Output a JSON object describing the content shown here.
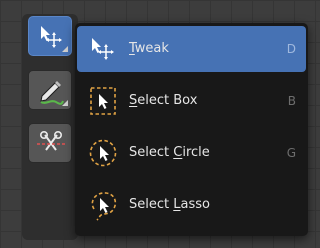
{
  "colors": {
    "accent": "#4672b4",
    "menu_bg": "#181818",
    "dashed_orange": "#e0a244",
    "shortcut_text": "#6d6d6d"
  },
  "toolbar": {
    "tools": [
      {
        "name": "tweak-tool-button",
        "icon": "tweak-cursor-icon",
        "active": true
      },
      {
        "name": "annotate-tool-button",
        "icon": "annotate-pencil-icon",
        "active": false
      },
      {
        "name": "cut-tool-button",
        "icon": "scissors-icon",
        "active": false
      }
    ]
  },
  "menu": {
    "items": [
      {
        "icon": "tweak-cursor-icon",
        "underline": "T",
        "rest": "weak",
        "shortcut": "D",
        "active": true
      },
      {
        "icon": "select-box-icon",
        "prefix": "",
        "underline": "S",
        "rest": "elect Box",
        "shortcut": "B",
        "active": false
      },
      {
        "icon": "select-circle-icon",
        "prefix": "Select ",
        "underline": "C",
        "rest": "ircle",
        "shortcut": "G",
        "active": false
      },
      {
        "icon": "select-lasso-icon",
        "prefix": "Select ",
        "underline": "L",
        "rest": "asso",
        "shortcut": "",
        "active": false
      }
    ]
  }
}
